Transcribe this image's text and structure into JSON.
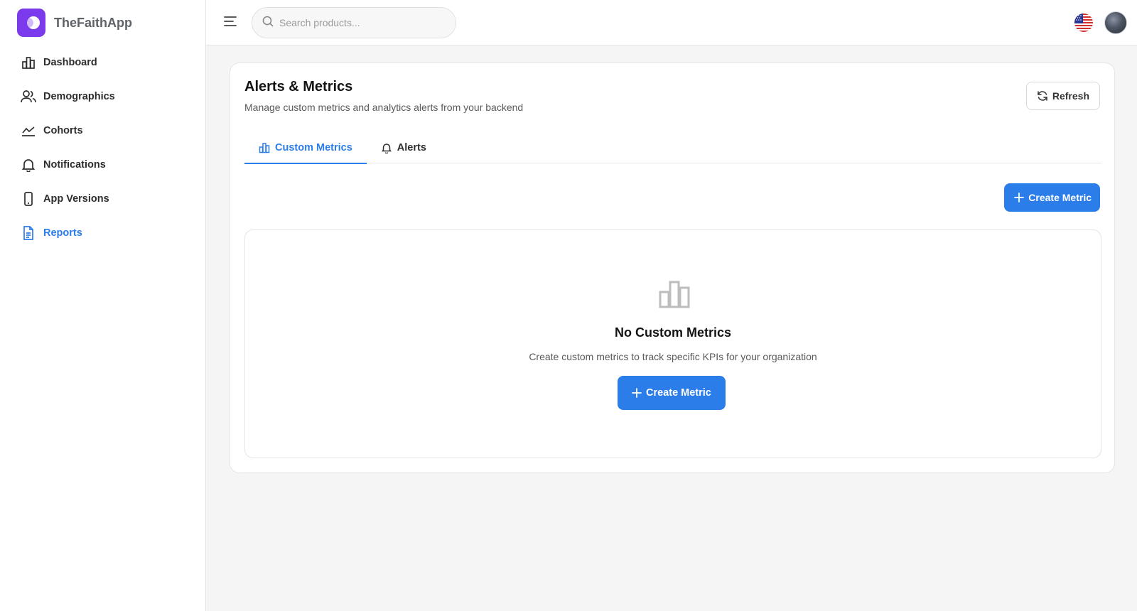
{
  "brand": {
    "name": "TheFaithApp",
    "logo_color": "#7c3aed"
  },
  "sidebar": {
    "items": [
      {
        "label": "Dashboard",
        "icon": "bar-chart-icon",
        "active": false
      },
      {
        "label": "Demographics",
        "icon": "users-icon",
        "active": false
      },
      {
        "label": "Cohorts",
        "icon": "line-chart-icon",
        "active": false
      },
      {
        "label": "Notifications",
        "icon": "bell-icon",
        "active": false
      },
      {
        "label": "App Versions",
        "icon": "smartphone-icon",
        "active": false
      },
      {
        "label": "Reports",
        "icon": "document-icon",
        "active": true
      }
    ]
  },
  "topbar": {
    "search_placeholder": "Search products...",
    "language_flag": "us-flag-icon",
    "avatar": "user-avatar"
  },
  "page": {
    "title": "Alerts & Metrics",
    "subtitle": "Manage custom metrics and analytics alerts from your backend",
    "refresh_label": "Refresh",
    "tabs": [
      {
        "label": "Custom Metrics",
        "icon": "bar-chart-icon",
        "active": true
      },
      {
        "label": "Alerts",
        "icon": "bell-icon",
        "active": false
      }
    ],
    "create_metric_label": "Create Metric",
    "empty": {
      "title": "No Custom Metrics",
      "description": "Create custom metrics to track specific KPIs for your organization",
      "button_label": "Create Metric"
    }
  },
  "colors": {
    "accent": "#2b7de9",
    "brand": "#7c3aed",
    "background": "#f5f5f5"
  }
}
